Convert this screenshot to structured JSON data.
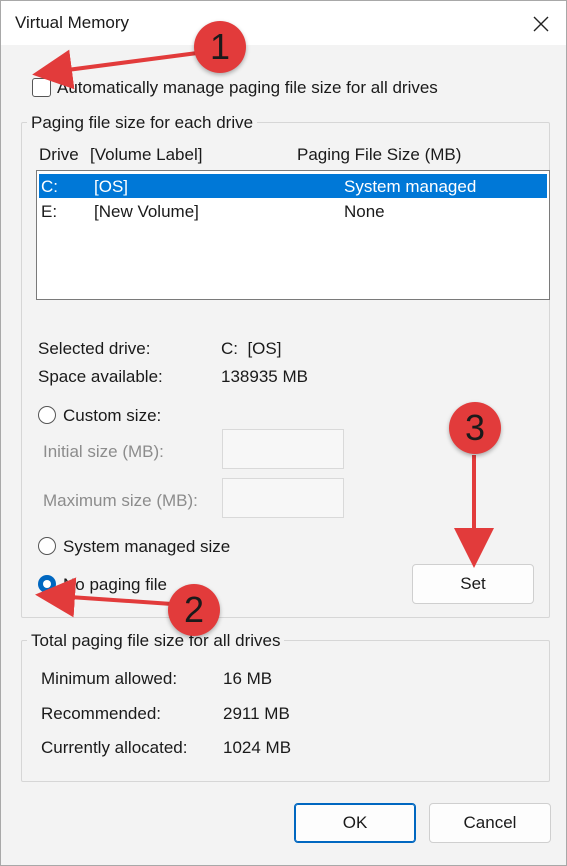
{
  "window": {
    "title": "Virtual Memory"
  },
  "auto_manage": {
    "label": "Automatically manage paging file size for all drives",
    "checked": false
  },
  "drives_group": {
    "title": "Paging file size for each drive",
    "headers": {
      "drive": "Drive",
      "volume": "[Volume Label]",
      "size": "Paging File Size (MB)"
    },
    "rows": [
      {
        "drive": "C:",
        "label": "[OS]",
        "size": "System managed",
        "selected": true
      },
      {
        "drive": "E:",
        "label": "[New Volume]",
        "size": "None",
        "selected": false
      }
    ],
    "selected_drive_label": "Selected drive:",
    "selected_drive_value": "C:  [OS]",
    "space_available_label": "Space available:",
    "space_available_value": "138935 MB",
    "custom_size_label": "Custom size:",
    "initial_size_label": "Initial size (MB):",
    "maximum_size_label": "Maximum size (MB):",
    "system_managed_label": "System managed size",
    "no_paging_label": "No paging file",
    "selected_option": "no_paging",
    "set_button": "Set"
  },
  "total_group": {
    "title": "Total paging file size for all drives",
    "min_label": "Minimum allowed:",
    "min_value": "16 MB",
    "rec_label": "Recommended:",
    "rec_value": "2911 MB",
    "alloc_label": "Currently allocated:",
    "alloc_value": "1024 MB"
  },
  "buttons": {
    "ok": "OK",
    "cancel": "Cancel"
  },
  "annotations": {
    "badge1": "1",
    "badge2": "2",
    "badge3": "3",
    "color": "#e23b3b"
  }
}
